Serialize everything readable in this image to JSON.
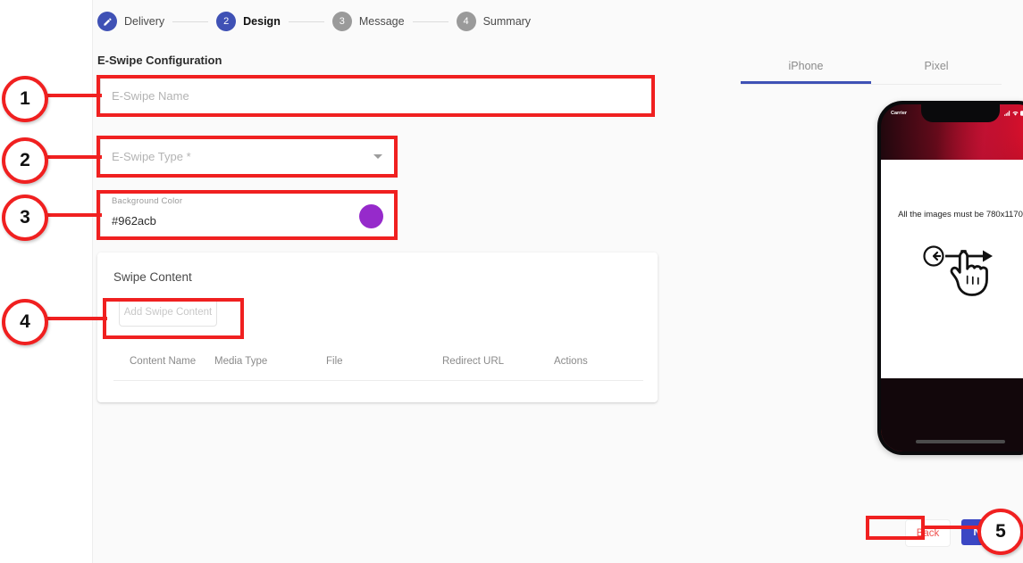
{
  "stepper": {
    "steps": [
      {
        "badge": "check-edit",
        "label": "Delivery",
        "state": "done"
      },
      {
        "badge": "2",
        "label": "Design",
        "state": "active"
      },
      {
        "badge": "3",
        "label": "Message",
        "state": "todo"
      },
      {
        "badge": "4",
        "label": "Summary",
        "state": "todo"
      }
    ]
  },
  "form": {
    "section_title": "E-Swipe Configuration",
    "name_field": {
      "placeholder": "E-Swipe Name",
      "value": ""
    },
    "type_field": {
      "placeholder": "E-Swipe Type *",
      "value": ""
    },
    "color_field": {
      "label": "Background Color",
      "value": "#962acb",
      "swatch_color": "#962acb"
    }
  },
  "swipe_content": {
    "title": "Swipe Content",
    "add_button": "Add Swipe Content",
    "columns": [
      "Content Name",
      "Media Type",
      "File",
      "Redirect URL",
      "Actions"
    ],
    "rows": []
  },
  "preview": {
    "tabs": [
      {
        "label": "iPhone",
        "selected": true
      },
      {
        "label": "Pixel",
        "selected": false
      }
    ],
    "phone": {
      "status_carrier": "Carrier",
      "screen_text": "All the images must be 780x1170"
    }
  },
  "footer": {
    "back_label": "Back",
    "next_label": "Next"
  },
  "annotations": {
    "markers": [
      "1",
      "2",
      "3",
      "4",
      "5"
    ]
  },
  "colors": {
    "accent_blue": "#3f51b5",
    "next_blue": "#3b47c4",
    "back_red": "#ef5350",
    "annotation_red": "#f02020",
    "swatch_purple": "#962acb"
  }
}
